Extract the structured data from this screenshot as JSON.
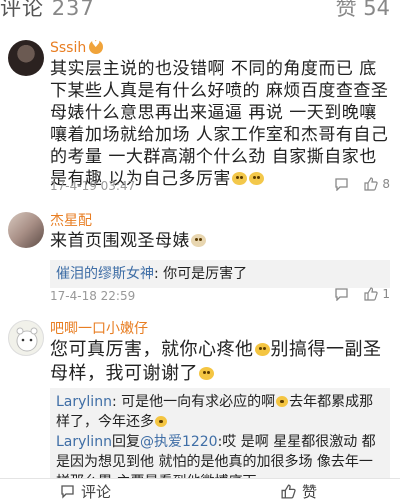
{
  "header": {
    "comments_label": "评论",
    "comments_count": "237",
    "likes_label": "赞",
    "likes_count": "54"
  },
  "comments": [
    {
      "username": "Sssih",
      "text": "其实层主说的也没错啊 不同的角度而已 底下某些人真是有什么好喷的 麻烦百度查查圣母婊什么意思再出来逼逼 再说 一天到晚嚷嚷着加场就给加场 人家工作室和杰哥有自己的考量 一大群高潮个什么劲 自家撕自家也是有趣 以为自己多厉害",
      "timestamp": "17-4-19 03:47",
      "like_count": "8"
    },
    {
      "username": "杰星配",
      "text": "来首页围观圣母婊",
      "reply": {
        "name": "催泪的缪斯女神",
        "text": ": 你可是厉害了"
      },
      "timestamp": "17-4-18 22:59",
      "like_count": "1"
    },
    {
      "username": "吧唧一口小嫩仔",
      "text_part1": "您可真厉害，就你心疼他",
      "text_part2": "别搞得一副圣母样，我可谢谢了",
      "replies": [
        {
          "name": "Larylinn",
          "text": ": 可是他一向有求必应的啊",
          "text2": "去年都累成那样了，今年还多"
        },
        {
          "name": "Larylinn",
          "text": "回复",
          "mention": "@执爱1220",
          "text2": ":哎 是啊 星星都很激动 都是因为想见到他 就怕的是他真的加很多场 像去年一样那么累 主要是看到他微博底下"
        }
      ]
    }
  ],
  "bottom": {
    "comment_label": "评论",
    "like_label": "赞"
  },
  "colors": {
    "username": "#e87e23",
    "link": "#3f6ea6",
    "reply_bg": "#f2f2f2",
    "meta": "#999999"
  }
}
